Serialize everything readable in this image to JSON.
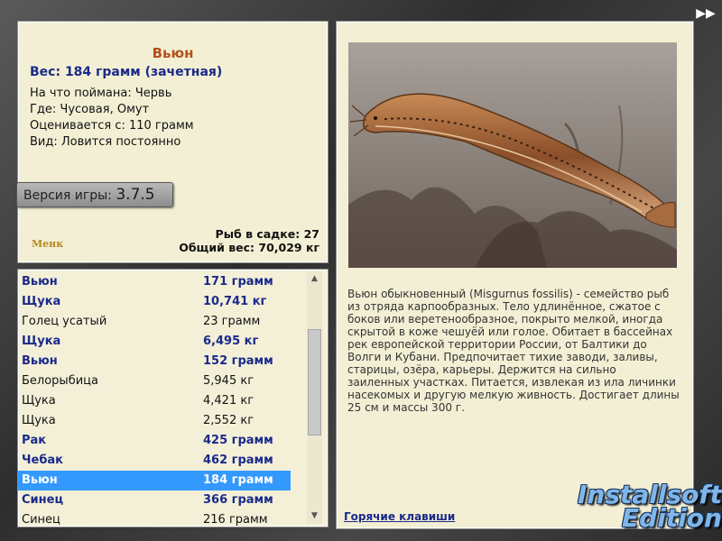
{
  "fish": {
    "name": "Вьюн",
    "weight_line": "Вес: 184 грамм (зачетная)",
    "caught_on": "На что поймана: Червь",
    "location": "Где: Чусовая, Омут",
    "rated_from": "Оценивается с: 110 грамм",
    "kind": "Вид: Ловится постоянно"
  },
  "version": {
    "label": "Версия игры:",
    "number": "3.7.5"
  },
  "small_logo": "Менк",
  "stats": {
    "in_keepnet": "Рыб в садке: 27",
    "total_weight": "Общий вес: 70,029 кг"
  },
  "catch_list": [
    {
      "name": "Вьюн",
      "weight": "171 грамм",
      "bold": true
    },
    {
      "name": "Щука",
      "weight": "10,741 кг",
      "bold": true
    },
    {
      "name": "Голец усатый",
      "weight": "23 грамм",
      "bold": false
    },
    {
      "name": "Щука",
      "weight": "6,495 кг",
      "bold": true
    },
    {
      "name": "Вьюн",
      "weight": "152 грамм",
      "bold": true
    },
    {
      "name": "Белорыбица",
      "weight": "5,945 кг",
      "bold": false
    },
    {
      "name": "Щука",
      "weight": "4,421 кг",
      "bold": false
    },
    {
      "name": "Щука",
      "weight": "2,552 кг",
      "bold": false
    },
    {
      "name": "Рак",
      "weight": "425 грамм",
      "bold": true
    },
    {
      "name": "Чебак",
      "weight": "462 грамм",
      "bold": true
    },
    {
      "name": "Вьюн",
      "weight": "184 грамм",
      "bold": true,
      "selected": true
    },
    {
      "name": "Синец",
      "weight": "366 грамм",
      "bold": true
    },
    {
      "name": "Синец",
      "weight": "216 грамм",
      "bold": false
    }
  ],
  "description": "Вьюн обыкновенный (Misgurnus fossilis) - семейство рыб из отряда карпообразных. Тело удлинённое, сжатое с боков или веретенообразное, покрыто мелкой, иногда скрытой в коже чешуёй или голое. Обитает в бассейнах рек европейской территории России, от Балтики до Волги и Кубани. Предпочитает тихие заводи, заливы, старицы, озёра, карьеры. Держится на сильно заиленных участках. Питается, извлекая из ила личинки насекомых и другую мелкую живность. Достигает длины 25 см и массы 300 г.",
  "hotkeys": "Горячие клавиши",
  "ff_icon": "fast-forward-icon",
  "watermark": {
    "line1": "Installsoft",
    "line2": "Edition"
  },
  "colors": {
    "title": "#b8501a",
    "blue_text": "#1a2a8a",
    "panel_bg": "#f3efd4",
    "selection": "#3399ff"
  }
}
